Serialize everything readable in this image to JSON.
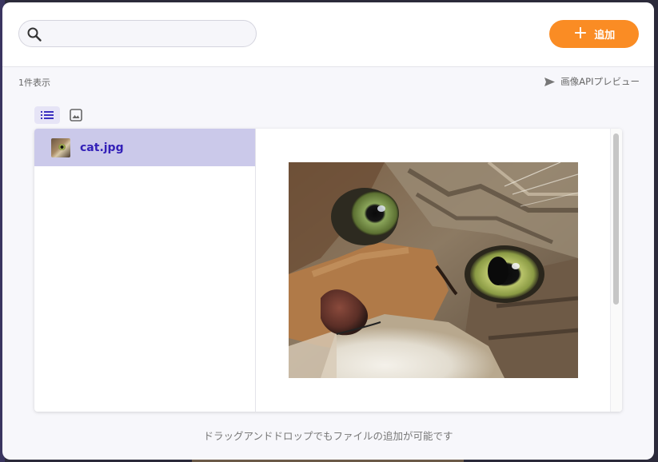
{
  "search": {
    "value": "",
    "placeholder": ""
  },
  "header": {
    "add_button_label": "追加"
  },
  "toolbar": {
    "count_text": "1件表示",
    "api_preview_label": "画像APIプレビュー"
  },
  "view_modes": [
    {
      "icon": "list-icon",
      "active": true
    },
    {
      "icon": "image-icon",
      "active": false
    }
  ],
  "files": [
    {
      "name": "cat.jpg",
      "selected": true
    }
  ],
  "footer": {
    "hint": "ドラッグアンドドロップでもファイルの追加が可能です"
  },
  "colors": {
    "accent": "#fa8c24",
    "selected_row": "#cbc9ea",
    "file_name": "#3320b8"
  }
}
